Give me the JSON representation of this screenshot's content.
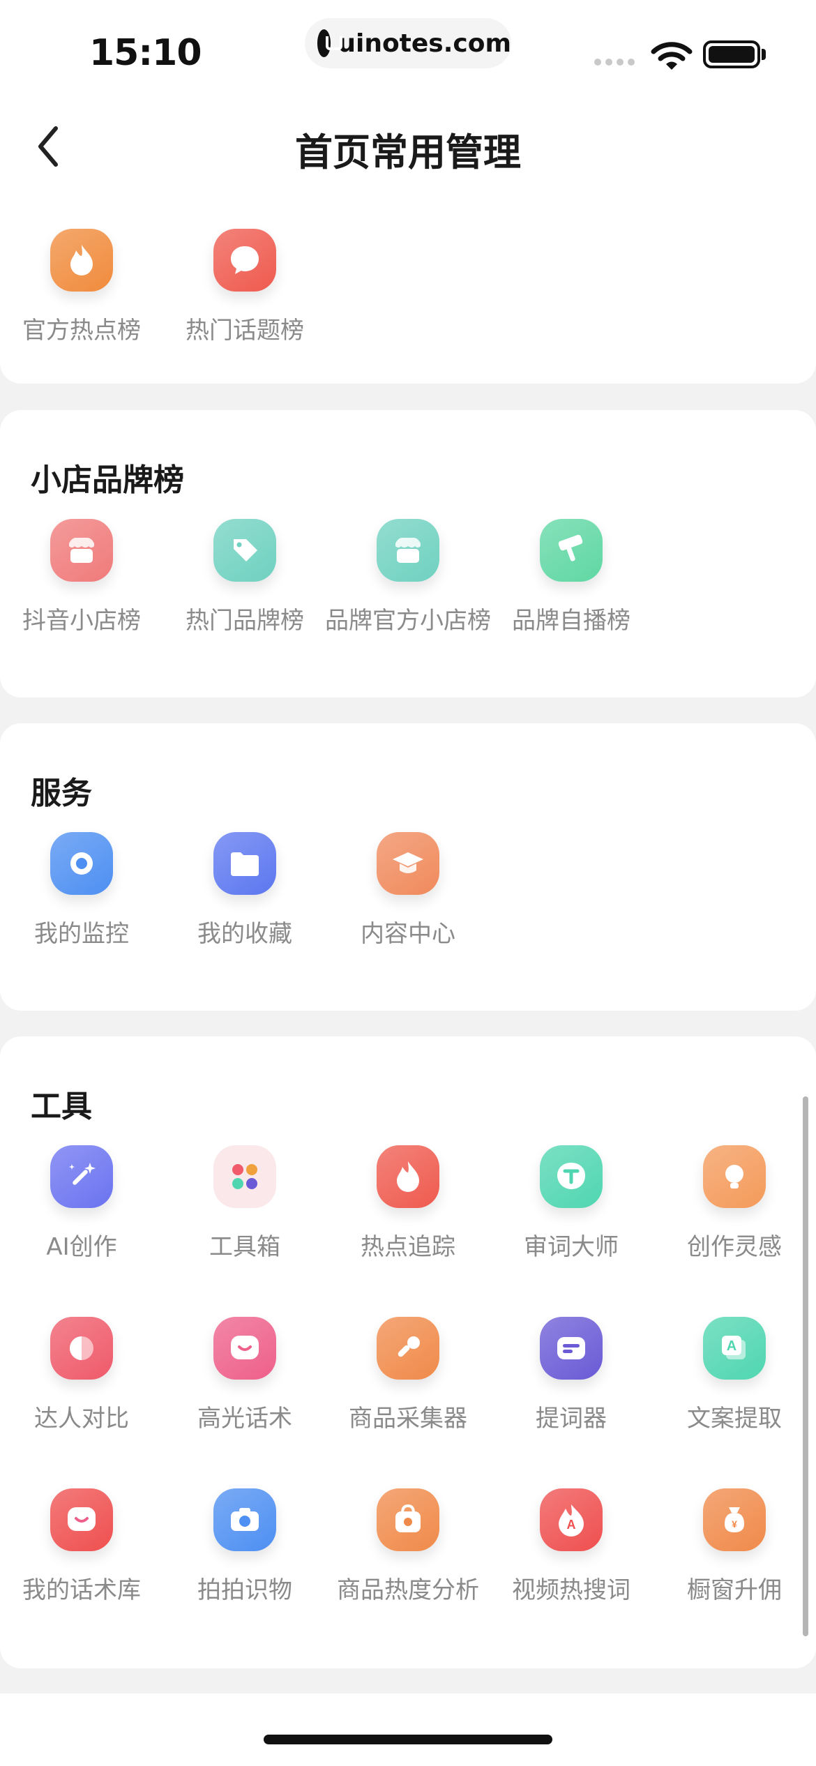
{
  "status_bar": {
    "time": "15:10",
    "url": "uinotes.com"
  },
  "header": {
    "title": "首页常用管理"
  },
  "sections": [
    {
      "title": "",
      "items": [
        {
          "label": "官方热点榜",
          "icon": "flame-icon",
          "color": "#f08b3c"
        },
        {
          "label": "热门话题榜",
          "icon": "chat-bubble-icon",
          "color": "#ef5a4e"
        }
      ]
    },
    {
      "title": "小店品牌榜",
      "items": [
        {
          "label": "抖音小店榜",
          "icon": "shop-icon",
          "color": "#f07a7a"
        },
        {
          "label": "热门品牌榜",
          "icon": "tag-icon",
          "color": "#6fd1c0"
        },
        {
          "label": "品牌官方小店榜",
          "icon": "shop-icon",
          "color": "#6fd1c0"
        },
        {
          "label": "品牌自播榜",
          "icon": "hammer-icon",
          "color": "#5fd7a3"
        }
      ]
    },
    {
      "title": "服务",
      "items": [
        {
          "label": "我的监控",
          "icon": "monitor-eye-icon",
          "color": "#4d8ff2"
        },
        {
          "label": "我的收藏",
          "icon": "folder-icon",
          "color": "#5c77f0"
        },
        {
          "label": "内容中心",
          "icon": "graduation-cap-icon",
          "color": "#f08a5c"
        }
      ]
    },
    {
      "title": "工具",
      "items": [
        {
          "label": "AI创作",
          "icon": "magic-wand-icon",
          "color": "#6b73f0"
        },
        {
          "label": "工具箱",
          "icon": "toolbox-icon",
          "color": "#fbe8ea"
        },
        {
          "label": "热点追踪",
          "icon": "flame-icon",
          "color": "#ef5a4e"
        },
        {
          "label": "审词大师",
          "icon": "t-bubble-icon",
          "color": "#4fd6b0"
        },
        {
          "label": "创作灵感",
          "icon": "lightbulb-icon",
          "color": "#f49a5a"
        },
        {
          "label": "达人对比",
          "icon": "half-circle-icon",
          "color": "#ef5a6a"
        },
        {
          "label": "高光话术",
          "icon": "smile-bubble-icon",
          "color": "#ee5f8a"
        },
        {
          "label": "商品采集器",
          "icon": "pipette-icon",
          "color": "#f08a4a"
        },
        {
          "label": "提词器",
          "icon": "prompter-icon",
          "color": "#6a5ad6"
        },
        {
          "label": "文案提取",
          "icon": "text-extract-icon",
          "color": "#4fd6b0"
        },
        {
          "label": "我的话术库",
          "icon": "smile-bubble-icon",
          "color": "#ef4f4f"
        },
        {
          "label": "拍拍识物",
          "icon": "camera-icon",
          "color": "#4d8ff2"
        },
        {
          "label": "商品热度分析",
          "icon": "bag-icon",
          "color": "#f08a4a"
        },
        {
          "label": "视频热搜词",
          "icon": "flame-a-icon",
          "color": "#ef4f4f"
        },
        {
          "label": "橱窗升佣",
          "icon": "money-bag-icon",
          "color": "#f08a4a"
        }
      ]
    }
  ]
}
